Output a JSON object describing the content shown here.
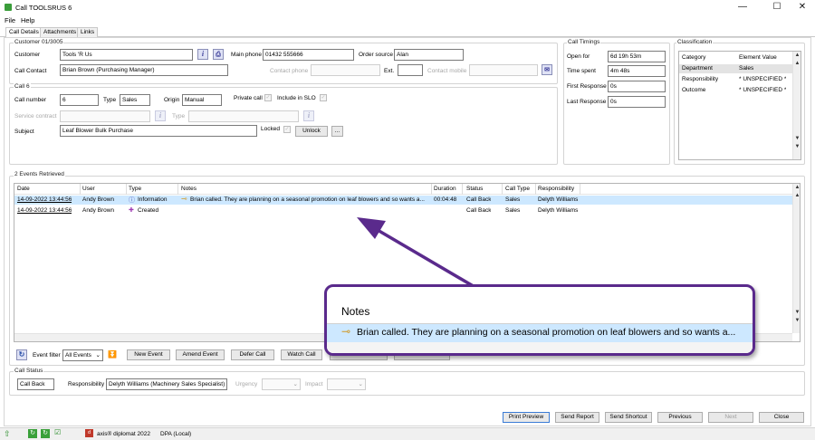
{
  "window": {
    "title": "Call TOOLSRUS 6",
    "minimize": "—",
    "maximize": "☐",
    "close": "✕"
  },
  "menu": [
    "File",
    "Help"
  ],
  "tabs": [
    "Call Details",
    "Attachments",
    "Links"
  ],
  "customer": {
    "group_label": "Customer 01/3005",
    "customer_label": "Customer",
    "customer_value": "Tools 'R Us",
    "main_phone_label": "Main phone",
    "main_phone_value": "01432 555666",
    "order_source_label": "Order source",
    "order_source_value": "Alan",
    "call_contact_label": "Call Contact",
    "call_contact_value": "Brian Brown (Purchasing Manager)",
    "contact_phone_label": "Contact phone",
    "ext_label": "Ext.",
    "contact_mobile_label": "Contact mobile"
  },
  "call": {
    "group_label": "Call 6",
    "call_number_label": "Call number",
    "call_number_value": "6",
    "type_label": "Type",
    "type_value": "Sales",
    "origin_label": "Origin",
    "origin_value": "Manual",
    "private_call_label": "Private call",
    "include_slo_label": "Include in SLO",
    "service_contract_label": "Service contract",
    "type2_label": "Type",
    "subject_label": "Subject",
    "subject_value": "Leaf Blower Bulk Purchase",
    "locked_label": "Locked",
    "unlock_button": "Unlock",
    "more_button": "..."
  },
  "timings": {
    "group_label": "Call Timings",
    "open_for_label": "Open for",
    "open_for_value": "6d 19h 53m",
    "time_spent_label": "Time spent",
    "time_spent_value": "4m 48s",
    "first_response_label": "First Response",
    "first_response_value": "0s",
    "last_response_label": "Last Response",
    "last_response_value": "0s"
  },
  "classification": {
    "group_label": "Classification",
    "headers": [
      "Category",
      "Element Value"
    ],
    "rows": [
      [
        "Department",
        "Sales"
      ],
      [
        "Responsibility",
        "* UNSPECIFIED *"
      ],
      [
        "Outcome",
        "* UNSPECIFIED *"
      ]
    ]
  },
  "events": {
    "group_label": "2 Events Retrieved",
    "headers": [
      "Date",
      "User",
      "Type",
      "Notes",
      "Duration",
      "Status",
      "Call Type",
      "Responsibility"
    ],
    "rows": [
      [
        "14-09-2022 13:44:56",
        "Andy Brown",
        "Information",
        "Brian called. They are planning on a seasonal promotion on leaf blowers and so wants a...",
        "00:04:48",
        "Call Back",
        "Sales",
        "Delyth Williams"
      ],
      [
        "14-09-2022 13:44:56",
        "Andy Brown",
        "Created",
        "",
        "",
        "Call Back",
        "Sales",
        "Delyth Williams"
      ]
    ],
    "event_filter_label": "Event filter",
    "event_filter_value": "All Events",
    "new_event": "New Event",
    "amend_event": "Amend Event",
    "defer_call": "Defer Call",
    "watch_call": "Watch Call"
  },
  "call_status": {
    "group_label": "Call Status",
    "status_value": "Call Back",
    "responsibility_label": "Responsibility",
    "responsibility_value": "Delyth Williams (Machinery Sales Specialist)",
    "urgency_label": "Urgency",
    "impact_label": "Impact"
  },
  "footer_buttons": [
    "Print Preview",
    "Send Report",
    "Send Shortcut",
    "Previous",
    "Next",
    "Close"
  ],
  "statusbar": {
    "product": "axis® diplomat 2022",
    "database": "DPA (Local)"
  },
  "callout": {
    "title": "Notes",
    "text": "Brian called. They are planning on a seasonal promotion on leaf blowers and so wants a..."
  },
  "colors": {
    "callout_border": "#5a2a8c",
    "selection": "#cde8ff",
    "arrow": "#5a2a8c"
  }
}
